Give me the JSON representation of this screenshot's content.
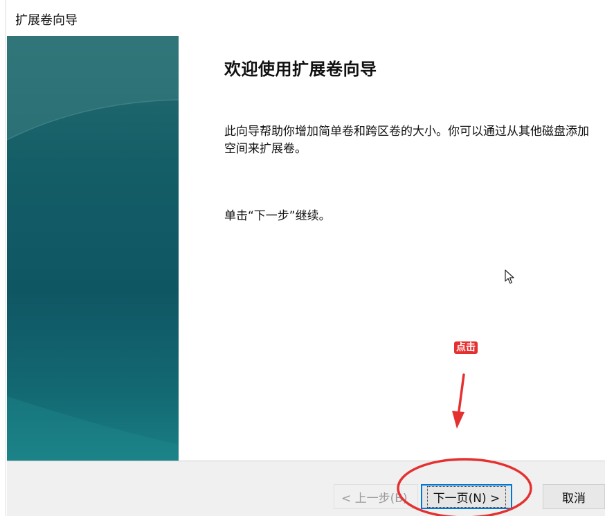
{
  "window": {
    "title": "扩展卷向导"
  },
  "content": {
    "heading": "欢迎使用扩展卷向导",
    "description": "此向导帮助你增加简单卷和跨区卷的大小。你可以通过从其他磁盘添加空间来扩展卷。",
    "hint": "单击“下一步”继续。"
  },
  "annotation": {
    "label": "点击",
    "color": "#e53030"
  },
  "footer": {
    "back_label": "< 上一步(B)",
    "next_label": "下一页(N) >",
    "cancel_label": "取消"
  },
  "colors": {
    "banner_teal": "#145e67",
    "focus_blue": "#0078d7",
    "annotation_red": "#e53030"
  }
}
